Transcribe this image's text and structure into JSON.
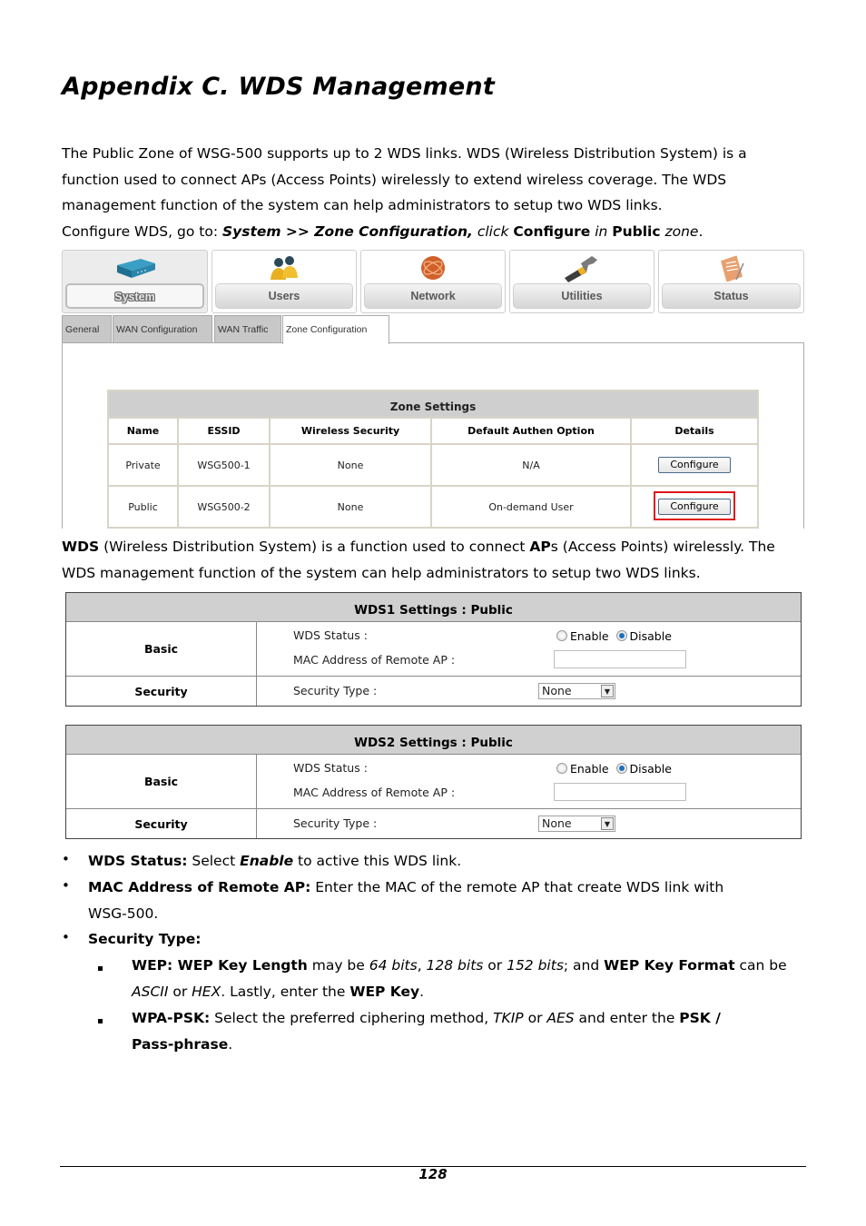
{
  "title": "Appendix C. WDS Management",
  "intro": {
    "line1": "The Public Zone of WSG-500 supports up to 2 WDS links. WDS (Wireless Distribution System) is a",
    "line2": "function used to connect APs (Access Points) wirelessly to extend wireless coverage. The WDS",
    "line3": "management function of the system can help administrators to setup two WDS links.",
    "nav_prefix": "Configure WDS, go to: ",
    "nav_path": "System >> Zone Configuration,",
    "nav_click": " click ",
    "nav_configure": "Configure",
    "nav_in": " in ",
    "nav_public": "Public",
    "nav_zone": " zone",
    "nav_end": "."
  },
  "screenshot": {
    "main_nav": [
      {
        "label": "System",
        "icon": "router-icon",
        "active": true
      },
      {
        "label": "Users",
        "icon": "users-icon",
        "active": false
      },
      {
        "label": "Network",
        "icon": "network-globe-icon",
        "active": false
      },
      {
        "label": "Utilities",
        "icon": "hammer-icon",
        "active": false
      },
      {
        "label": "Status",
        "icon": "document-status-icon",
        "active": false
      }
    ],
    "sub_tabs": [
      {
        "label": "General",
        "active": false
      },
      {
        "label": "WAN Configuration",
        "active": false
      },
      {
        "label": "WAN Traffic",
        "active": false
      },
      {
        "label": "Zone Configuration",
        "active": true
      }
    ],
    "zone_table": {
      "title": "Zone Settings",
      "columns": [
        "Name",
        "ESSID",
        "Wireless Security",
        "Default Authen Option",
        "Details"
      ],
      "rows": [
        {
          "name": "Private",
          "essid": "WSG500-1",
          "security": "None",
          "authen": "N/A",
          "details": "Configure"
        },
        {
          "name": "Public",
          "essid": "WSG500-2",
          "security": "None",
          "authen": "On-demand User",
          "details": "Configure"
        }
      ],
      "highlight_color": "#e0151b"
    }
  },
  "wds_para": {
    "b1": "WDS",
    "t1": " (Wireless Distribution System) is a function used to connect ",
    "b2": "AP",
    "t2": "s (Access Points) wirelessly. The",
    "line2": "WDS management function of the system can help administrators to setup two WDS links."
  },
  "wds_tables": [
    {
      "title": "WDS1 Settings : Public",
      "basic_label": "Basic",
      "status_label": "WDS Status :",
      "enable_label": "Enable",
      "disable_label": "Disable",
      "status_value": "Disable",
      "mac_label": "MAC Address of Remote AP :",
      "mac_value": "",
      "security_label": "Security",
      "security_type_label": "Security Type :",
      "security_type_value": "None"
    },
    {
      "title": "WDS2 Settings : Public",
      "basic_label": "Basic",
      "status_label": "WDS Status :",
      "enable_label": "Enable",
      "disable_label": "Disable",
      "status_value": "Disable",
      "mac_label": "MAC Address of Remote AP :",
      "mac_value": "",
      "security_label": "Security",
      "security_type_label": "Security Type :",
      "security_type_value": "None"
    }
  ],
  "bullets": {
    "b1_bold": "WDS Status:",
    "b1_text": " Select ",
    "b1_em": "Enable",
    "b1_end": " to active this WDS link.",
    "b2_bold": "MAC Address of Remote AP:",
    "b2_text": " Enter the MAC of the remote AP that create WDS link with",
    "b2_cont": "WSG-500.",
    "b3_bold": "Security Type:",
    "s1_bold": "WEP: WEP Key Length",
    "s1_t1": " may be ",
    "s1_i1": "64 bits",
    "s1_t2": ", ",
    "s1_i2": "128 bits",
    "s1_t3": " or ",
    "s1_i3": "152 bits",
    "s1_t4": "; and ",
    "s1_b2": "WEP Key Format",
    "s1_t5": " can be",
    "s1_i4": "ASCII",
    "s1_t6": " or ",
    "s1_i5": "HEX",
    "s1_t7": ". Lastly, enter the ",
    "s1_b3": "WEP Key",
    "s1_t8": ".",
    "s2_bold": "WPA-PSK:",
    "s2_t1": " Select the preferred ciphering method, ",
    "s2_i1": "TKIP",
    "s2_t2": " or ",
    "s2_i2": "AES",
    "s2_t3": " and enter the ",
    "s2_b2": "PSK /",
    "s2_b3": "Pass-phrase",
    "s2_t4": "."
  },
  "page_number": "128"
}
